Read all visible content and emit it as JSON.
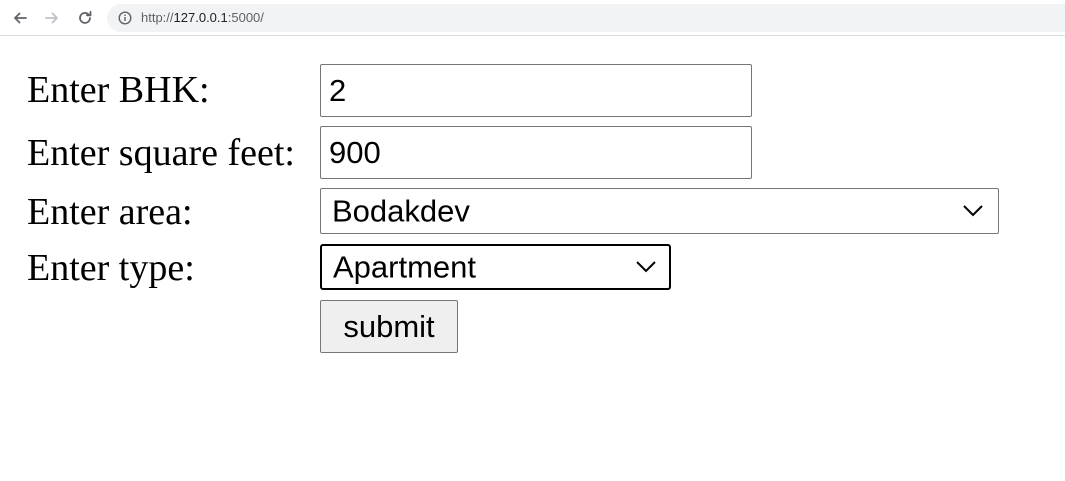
{
  "browser": {
    "url_scheme": "http://",
    "url_host": "127.0.0.1",
    "url_port_path": ":5000/"
  },
  "form": {
    "bhk": {
      "label": "Enter BHK:",
      "value": "2"
    },
    "sqft": {
      "label": "Enter square feet:",
      "value": "900"
    },
    "area": {
      "label": "Enter area:",
      "selected": "Bodakdev"
    },
    "type": {
      "label": "Enter type:",
      "selected": "Apartment"
    },
    "submit_label": "submit"
  },
  "icons": {
    "back": "arrow-left-icon",
    "forward": "arrow-right-icon",
    "reload": "reload-icon",
    "info": "info-icon",
    "dropdown": "chevron-down-icon"
  },
  "colors": {
    "border": "#767676",
    "button_bg": "#efefef",
    "omnibox_bg": "#f1f3f4",
    "focus_border": "#000000"
  }
}
